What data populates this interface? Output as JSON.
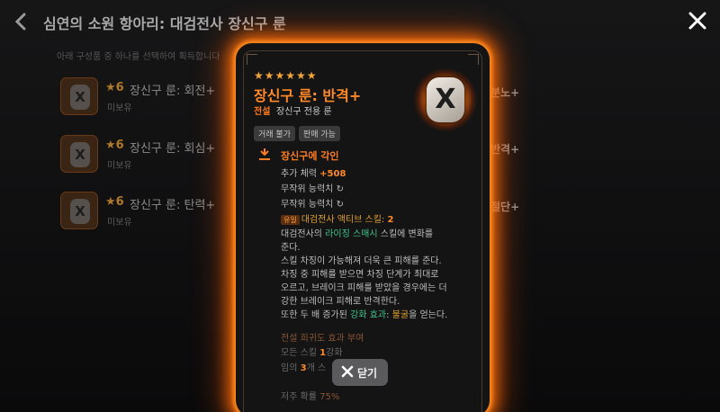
{
  "header": {
    "title": "심연의 소원 항아리: 대검전사 장신구 룬",
    "subtitle": "아래 구성품 중 하나를 선택하여 획득합니다"
  },
  "list": [
    {
      "stars": "★6",
      "name": "장신구 룬: 회전+",
      "owned": "미보유"
    },
    {
      "stars": "★6",
      "name": "장신구 룬: 회심+",
      "owned": "미보유"
    },
    {
      "stars": "★6",
      "name": "장신구 룬: 탄력+",
      "owned": "미보유"
    }
  ],
  "right_labels": [
    "분노+",
    "반격+",
    "절단+"
  ],
  "card": {
    "stars": "★★★★★★",
    "title": "장신구 룬: 반격+",
    "grade": "전설",
    "subtype": "장신구 전용 룬",
    "tags": [
      "거래 불가",
      "판매 가능"
    ],
    "section_title": "장신구에 각인",
    "stat_label": "추가 체력",
    "stat_value": "+508",
    "random1": "무작위 능력치",
    "random2": "무작위 능력치",
    "unique_tag": "유일",
    "skill_label": "대검전사 액티브 스킬:",
    "skill_value": "2",
    "desc1_pre": "대검전사의 ",
    "desc1_skill": "라이징 스매시",
    "desc1_post": " 스킬에 변화를",
    "desc2": "준다.",
    "desc3": "스킬 차징이 가능해져 더욱 큰 피해를 준다.",
    "desc4": "차징 중 피해를 받으면 차징 단계가 최대로",
    "desc5": "오르고, 브레이크 피해를 받았을 경우에는 더",
    "desc6": "강한 브레이크 피해로 반격한다.",
    "desc7_pre": "또한 두 배 증가된 ",
    "desc7_effect": "강화 효과",
    "desc7_colon": ": ",
    "desc7_buff": "불굴",
    "desc7_post": "을 얻는다.",
    "rarity_title": "전설 희귀도 효과 부여",
    "rarity1_pre": "모든 스킬 ",
    "rarity1_num": "1",
    "rarity1_post": "강화",
    "rarity2_pre": "임의 ",
    "rarity2_num": "3",
    "rarity2_post": "개 스",
    "curse_label": "저주 확률",
    "curse_value": "75%"
  },
  "close_button": {
    "label": "닫기"
  },
  "colors": {
    "accent": "#ff8a2a",
    "glow": "#ff7a10",
    "skill": "#42c28c"
  }
}
